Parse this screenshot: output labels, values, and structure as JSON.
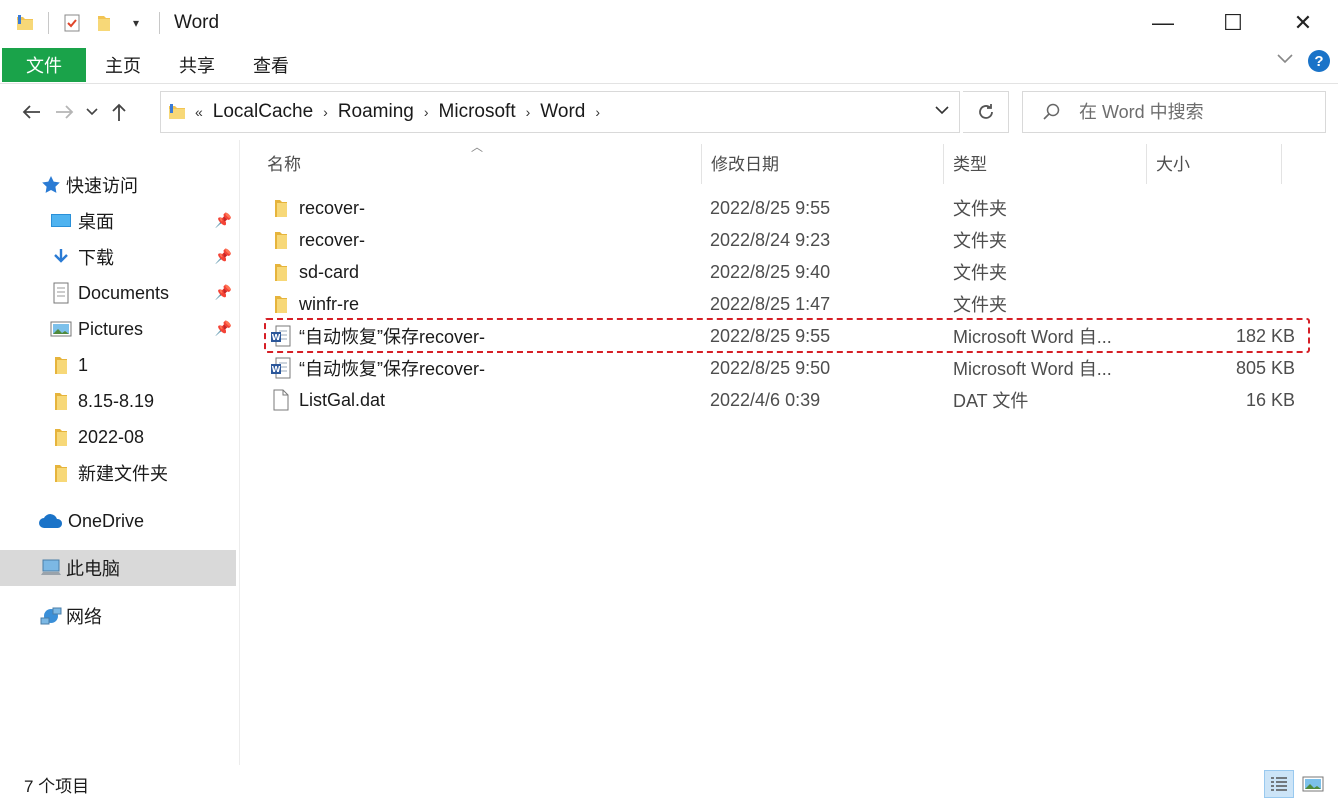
{
  "window": {
    "title": "Word",
    "controls": {
      "minimize": "—",
      "maximize": "☐",
      "close": "✕"
    }
  },
  "ribbon": {
    "file_tab": "文件",
    "tabs": [
      "主页",
      "共享",
      "查看"
    ]
  },
  "address": {
    "overflow": "«",
    "crumbs": [
      "LocalCache",
      "Roaming",
      "Microsoft",
      "Word"
    ]
  },
  "search": {
    "placeholder": "在 Word 中搜索"
  },
  "sidebar": {
    "quick_access": "快速访问",
    "items": [
      {
        "label": "桌面",
        "icon": "desktop-icon",
        "pinned": true
      },
      {
        "label": "下载",
        "icon": "download-icon",
        "pinned": true
      },
      {
        "label": "Documents",
        "icon": "document-icon",
        "pinned": true
      },
      {
        "label": "Pictures",
        "icon": "pictures-icon",
        "pinned": true
      },
      {
        "label": "1",
        "icon": "folder-icon",
        "pinned": false
      },
      {
        "label": "8.15-8.19",
        "icon": "folder-icon",
        "pinned": false
      },
      {
        "label": "2022-08",
        "icon": "folder-icon",
        "pinned": false
      },
      {
        "label": "新建文件夹",
        "icon": "folder-icon",
        "pinned": false
      }
    ],
    "onedrive": "OneDrive",
    "this_pc": "此电脑",
    "network": "网络"
  },
  "columns": {
    "name": "名称",
    "modified": "修改日期",
    "type": "类型",
    "size": "大小"
  },
  "files": [
    {
      "name": "recover-",
      "modified": "2022/8/25 9:55",
      "type": "文件夹",
      "size": "",
      "icon": "folder-icon"
    },
    {
      "name": "recover-",
      "modified": "2022/8/24 9:23",
      "type": "文件夹",
      "size": "",
      "icon": "folder-icon"
    },
    {
      "name": "sd-card",
      "modified": "2022/8/25 9:40",
      "type": "文件夹",
      "size": "",
      "icon": "folder-icon"
    },
    {
      "name": "winfr-re",
      "modified": "2022/8/25 1:47",
      "type": "文件夹",
      "size": "",
      "icon": "folder-icon"
    },
    {
      "name": "“自动恢复”保存recover-",
      "modified": "2022/8/25 9:55",
      "type": "Microsoft Word 自...",
      "size": "182 KB",
      "icon": "word-doc-icon"
    },
    {
      "name": "“自动恢复”保存recover-",
      "modified": "2022/8/25 9:50",
      "type": "Microsoft Word 自...",
      "size": "805 KB",
      "icon": "word-doc-icon"
    },
    {
      "name": "ListGal.dat",
      "modified": "2022/4/6 0:39",
      "type": "DAT 文件",
      "size": "16 KB",
      "icon": "file-icon"
    }
  ],
  "status": {
    "item_count": "7 个项目"
  },
  "colors": {
    "accent": "#1aa34a",
    "highlight": "#d61f26",
    "selected": "#d9d9d9"
  }
}
